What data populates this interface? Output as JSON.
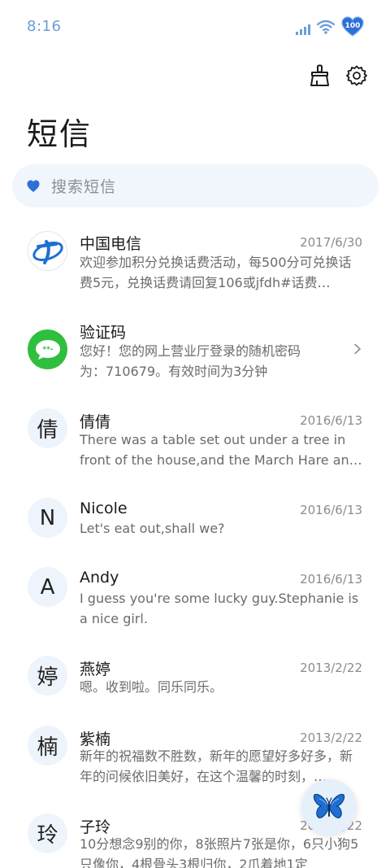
{
  "status_bar": {
    "time": "8:16",
    "battery": "100",
    "accent": "#6a9fd6"
  },
  "toolbar": {
    "clean_icon": "brush-icon",
    "settings_icon": "gear-icon"
  },
  "page": {
    "title": "短信"
  },
  "search": {
    "placeholder": "搜索短信"
  },
  "messages": [
    {
      "sender": "中国电信",
      "date": "2017/6/30",
      "preview": "欢迎参加积分兑换话费活动，每500分可兑换话费5元，兑换话费请回复106或jfdh#话费…",
      "avatar": "china-telecom-logo"
    },
    {
      "sender": "验证码",
      "date": "",
      "preview": "您好！您的网上营业厅登录的随机密码为：710679。有效时间为3分钟",
      "avatar": "message-bubble-icon"
    },
    {
      "sender": "倩倩",
      "date": "2016/6/13",
      "preview": "There was a table set out under a tree in front of the house,and the March Hare an…",
      "avatar": "倩"
    },
    {
      "sender": "Nicole",
      "date": "2016/6/13",
      "preview": "Let's eat out,shall we?",
      "avatar": "N"
    },
    {
      "sender": "Andy",
      "date": "2016/6/13",
      "preview": "I guess you're some lucky guy.Stephanie is a nice girl.",
      "avatar": "A"
    },
    {
      "sender": "燕婷",
      "date": "2013/2/22",
      "preview": "嗯。收到啦。同乐同乐。",
      "avatar": "婷"
    },
    {
      "sender": "紫楠",
      "date": "2013/2/22",
      "preview": "新年的祝福数不胜数，新年的愿望好多好多，新年的问候依旧美好，在这个温馨的时刻，…",
      "avatar": "楠"
    },
    {
      "sender": "子玲",
      "date": "2013/2/22",
      "preview": "10分想念9别的你，8张照片7张是你，6只小狗5只像你，4根骨头3根归你，2爪着地1定",
      "avatar": "玲"
    }
  ],
  "fab": {
    "icon": "butterfly-icon"
  }
}
